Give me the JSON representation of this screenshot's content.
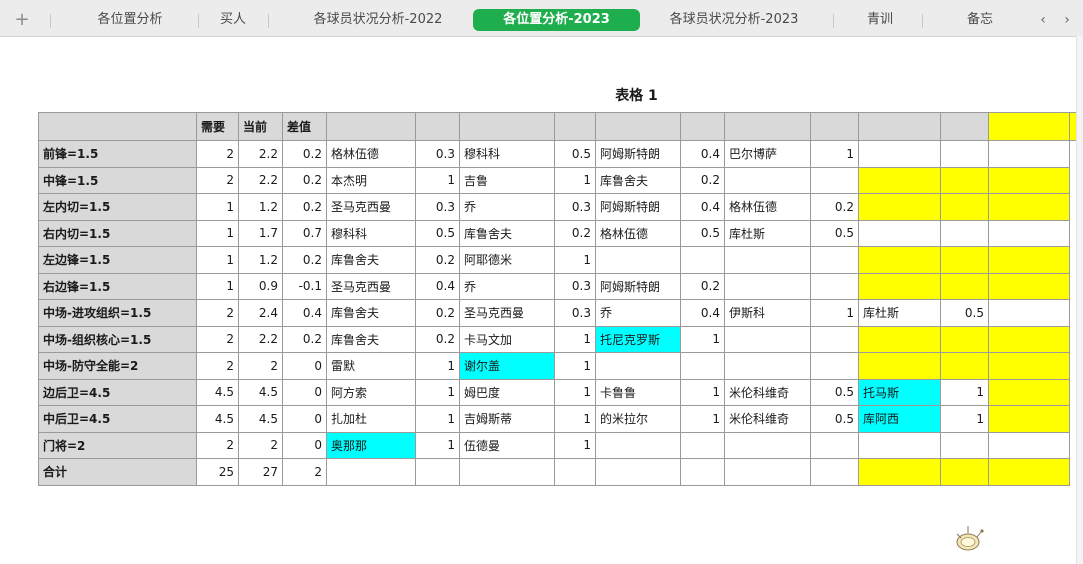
{
  "tabs": {
    "add_label": "+",
    "items": [
      {
        "label": "各位置分析",
        "active": false
      },
      {
        "label": "买人",
        "active": false
      },
      {
        "label": "各球员状况分析-2022",
        "active": false
      },
      {
        "label": "各位置分析-2023",
        "active": true
      },
      {
        "label": "各球员状况分析-2023",
        "active": false
      },
      {
        "label": "青训",
        "active": false
      },
      {
        "label": "备忘",
        "active": false
      }
    ],
    "prev_label": "‹",
    "next_label": "›"
  },
  "sheet": {
    "title": "表格 1",
    "headers": [
      "",
      "需要",
      "当前",
      "差值",
      "",
      "",
      "",
      "",
      "",
      "",
      "",
      "",
      "",
      "",
      "",
      ""
    ],
    "rows": [
      {
        "label": "前锋=1.5",
        "need": "2",
        "cur": "2.2",
        "diff": "0.2",
        "p": [
          [
            "格林伍德",
            "0.3"
          ],
          [
            "穆科科",
            "0.5"
          ],
          [
            "阿姆斯特朗",
            "0.4"
          ],
          [
            "巴尔博萨",
            "1"
          ],
          [
            "",
            ""
          ]
        ],
        "hl": [],
        "yellow": false
      },
      {
        "label": "中锋=1.5",
        "need": "2",
        "cur": "2.2",
        "diff": "0.2",
        "p": [
          [
            "本杰明",
            "1"
          ],
          [
            "吉鲁",
            "1"
          ],
          [
            "库鲁舍夫",
            "0.2"
          ],
          [
            "",
            ""
          ],
          [
            "",
            ""
          ]
        ],
        "hl": [],
        "yellow": true
      },
      {
        "label": "左内切=1.5",
        "need": "1",
        "cur": "1.2",
        "diff": "0.2",
        "p": [
          [
            "圣马克西曼",
            "0.3"
          ],
          [
            "乔",
            "0.3"
          ],
          [
            "阿姆斯特朗",
            "0.4"
          ],
          [
            "格林伍德",
            "0.2"
          ],
          [
            "",
            ""
          ]
        ],
        "hl": [],
        "yellow": true
      },
      {
        "label": "右内切=1.5",
        "need": "1",
        "cur": "1.7",
        "diff": "0.7",
        "p": [
          [
            "穆科科",
            "0.5"
          ],
          [
            "库鲁舍夫",
            "0.2"
          ],
          [
            "格林伍德",
            "0.5"
          ],
          [
            "库杜斯",
            "0.5"
          ],
          [
            "",
            ""
          ]
        ],
        "hl": [],
        "yellow": false
      },
      {
        "label": "左边锋=1.5",
        "need": "1",
        "cur": "1.2",
        "diff": "0.2",
        "p": [
          [
            "库鲁舍夫",
            "0.2"
          ],
          [
            "阿耶德米",
            "1"
          ],
          [
            "",
            ""
          ],
          [
            "",
            ""
          ],
          [
            "",
            ""
          ]
        ],
        "hl": [],
        "yellow": true
      },
      {
        "label": "右边锋=1.5",
        "need": "1",
        "cur": "0.9",
        "diff": "-0.1",
        "p": [
          [
            "圣马克西曼",
            "0.4"
          ],
          [
            "乔",
            "0.3"
          ],
          [
            "阿姆斯特朗",
            "0.2"
          ],
          [
            "",
            ""
          ],
          [
            "",
            ""
          ]
        ],
        "hl": [],
        "yellow": true
      },
      {
        "label": "中场-进攻组织=1.5",
        "need": "2",
        "cur": "2.4",
        "diff": "0.4",
        "p": [
          [
            "库鲁舍夫",
            "0.2"
          ],
          [
            "圣马克西曼",
            "0.3"
          ],
          [
            "乔",
            "0.4"
          ],
          [
            "伊斯科",
            "1"
          ],
          [
            "库杜斯",
            "0.5"
          ]
        ],
        "hl": [],
        "yellow": false
      },
      {
        "label": "中场-组织核心=1.5",
        "need": "2",
        "cur": "2.2",
        "diff": "0.2",
        "p": [
          [
            "库鲁舍夫",
            "0.2"
          ],
          [
            "卡马文加",
            "1"
          ],
          [
            "托尼克罗斯",
            "1"
          ],
          [
            "",
            ""
          ],
          [
            "",
            ""
          ]
        ],
        "hl": [
          2
        ],
        "yellow": true
      },
      {
        "label": "中场-防守全能=2",
        "need": "2",
        "cur": "2",
        "diff": "0",
        "p": [
          [
            "雷默",
            "1"
          ],
          [
            "谢尔盖",
            "1"
          ],
          [
            "",
            ""
          ],
          [
            "",
            ""
          ],
          [
            "",
            ""
          ]
        ],
        "hl": [
          1
        ],
        "yellow": true
      },
      {
        "label": "边后卫=4.5",
        "need": "4.5",
        "cur": "4.5",
        "diff": "0",
        "p": [
          [
            "阿方索",
            "1"
          ],
          [
            "姆巴度",
            "1"
          ],
          [
            "卡鲁鲁",
            "1"
          ],
          [
            "米伦科维奇",
            "0.5"
          ],
          [
            "托马斯",
            "1"
          ]
        ],
        "hl": [
          4
        ],
        "yellow": true
      },
      {
        "label": "中后卫=4.5",
        "need": "4.5",
        "cur": "4.5",
        "diff": "0",
        "p": [
          [
            "扎加杜",
            "1"
          ],
          [
            "吉姆斯蒂",
            "1"
          ],
          [
            "的米拉尔",
            "1"
          ],
          [
            "米伦科维奇",
            "0.5"
          ],
          [
            "库阿西",
            "1"
          ]
        ],
        "hl": [
          4
        ],
        "yellow": true
      },
      {
        "label": "门将=2",
        "need": "2",
        "cur": "2",
        "diff": "0",
        "p": [
          [
            "奥那那",
            "1"
          ],
          [
            "伍德曼",
            "1"
          ],
          [
            "",
            ""
          ],
          [
            "",
            ""
          ],
          [
            "",
            ""
          ]
        ],
        "hl": [
          0
        ],
        "yellow": false
      },
      {
        "label": "合计",
        "need": "25",
        "cur": "27",
        "diff": "2",
        "p": [
          [
            "",
            ""
          ],
          [
            "",
            ""
          ],
          [
            "",
            ""
          ],
          [
            "",
            ""
          ],
          [
            "",
            ""
          ]
        ],
        "hl": [],
        "yellow": true
      }
    ]
  },
  "colors": {
    "active_tab": "#1fae4d",
    "header_fill": "#d9d9d9",
    "yellow": "#ffff00",
    "cyan": "#00ffff"
  },
  "icons": {
    "logo": "wps-logo-icon"
  }
}
